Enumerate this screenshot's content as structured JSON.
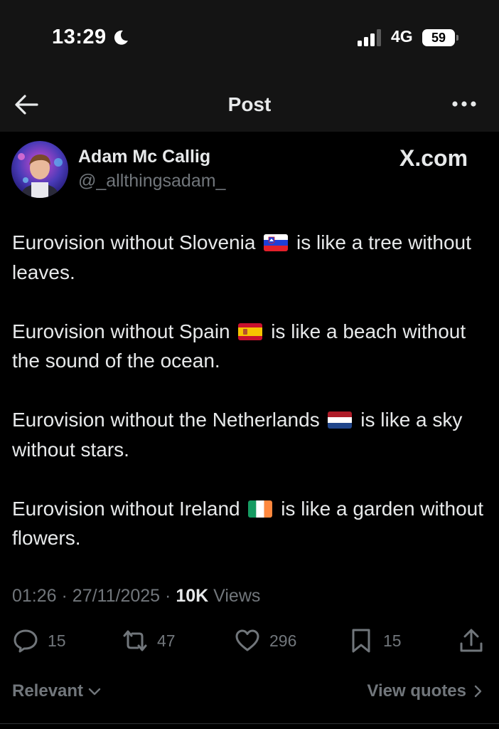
{
  "status_bar": {
    "time": "13:29",
    "network": "4G",
    "battery_level": "59",
    "icons": [
      "moon-icon",
      "signal-icon",
      "battery-icon"
    ]
  },
  "nav": {
    "title": "Post",
    "icons": [
      "back-arrow-icon",
      "more-icon"
    ]
  },
  "author": {
    "name": "Adam Mc Callig",
    "handle": "@_allthingsadam_",
    "source": "X.com"
  },
  "post": {
    "paragraphs": [
      {
        "before": "Eurovision without Slovenia",
        "flag": "slovenia-flag-icon",
        "after": "is like a tree without leaves."
      },
      {
        "before": "Eurovision without Spain",
        "flag": "spain-flag-icon",
        "after": "is like a beach without the sound of the ocean."
      },
      {
        "before": "Eurovision without the Netherlands",
        "flag": "netherlands-flag-icon",
        "after": "is like a sky without stars."
      },
      {
        "before": "Eurovision without Ireland",
        "flag": "ireland-flag-icon",
        "after": "is like a garden without flowers."
      }
    ]
  },
  "meta": {
    "time": "01:26",
    "sep1": "·",
    "date": "27/11/2025",
    "sep2": "·",
    "views_count": "10K",
    "views_label": "Views"
  },
  "actions": {
    "replies": "15",
    "reposts": "47",
    "likes": "296",
    "bookmarks": "15"
  },
  "footer": {
    "sort_label": "Relevant",
    "quotes_label": "View quotes"
  },
  "colors": {
    "background": "#000000",
    "bar_background": "#141414",
    "text_primary": "#e7e9ea",
    "text_secondary": "#71767b"
  }
}
